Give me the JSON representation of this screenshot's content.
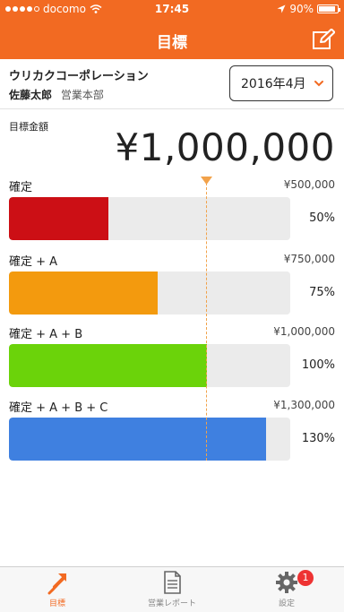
{
  "status_bar": {
    "carrier": "docomo",
    "time": "17:45",
    "battery": "90%"
  },
  "header": {
    "title": "目標",
    "edit_icon": "edit-icon"
  },
  "account": {
    "company": "ウリカクコーポレーション",
    "user_name": "佐藤太郎",
    "department": "営業本部"
  },
  "period": {
    "selected": "2016年4月"
  },
  "target": {
    "label": "目標金額",
    "amount": "¥1,000,000"
  },
  "rows": [
    {
      "label": "確定",
      "amount": "¥500,000",
      "percent_text": "50%",
      "ratio": 0.5,
      "color": "#cc0f15"
    },
    {
      "label": "確定 + A",
      "amount": "¥750,000",
      "percent_text": "75%",
      "ratio": 0.75,
      "color": "#f39a0e"
    },
    {
      "label": "確定 + A + B",
      "amount": "¥1,000,000",
      "percent_text": "100%",
      "ratio": 1.0,
      "color": "#6bd30a"
    },
    {
      "label": "確定 + A + B + C",
      "amount": "¥1,300,000",
      "percent_text": "130%",
      "ratio": 1.3,
      "color": "#3f80e0"
    }
  ],
  "tabs": [
    {
      "label": "目標",
      "icon": "target-arrow-icon",
      "active": true
    },
    {
      "label": "営業レポート",
      "icon": "document-icon",
      "active": false
    },
    {
      "label": "設定",
      "icon": "gear-icon",
      "active": false,
      "badge": "1"
    }
  ],
  "colors": {
    "brand": "#f26a22",
    "marker": "#f2a24a",
    "badge": "#ee3333"
  }
}
